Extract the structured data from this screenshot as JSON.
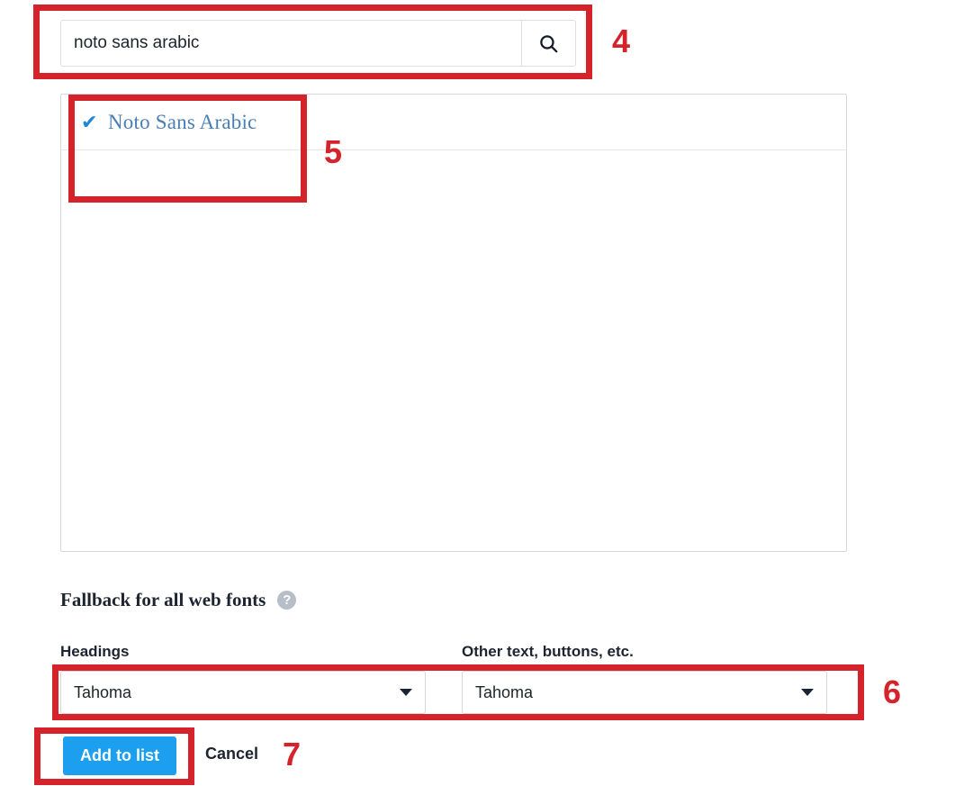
{
  "search": {
    "value": "noto sans arabic",
    "placeholder": "Search fonts",
    "button_icon": "search-icon"
  },
  "results": {
    "items": [
      {
        "name": "Noto Sans Arabic",
        "selected": true,
        "check_glyph": "✔"
      }
    ]
  },
  "fallback": {
    "title": "Fallback for all web fonts",
    "help_glyph": "?",
    "fields": [
      {
        "label": "Headings",
        "value": "Tahoma"
      },
      {
        "label": "Other text, buttons, etc.",
        "value": "Tahoma"
      }
    ],
    "caret_icon": "chevron-down-icon"
  },
  "actions": {
    "primary_label": "Add to list",
    "cancel_label": "Cancel"
  },
  "annotations": {
    "numbers": [
      "4",
      "5",
      "6",
      "7"
    ],
    "color": "#d4232b"
  },
  "colors": {
    "accent_blue": "#1d9ff0",
    "link_blue": "#4a7fb5",
    "check_blue": "#1d87d4",
    "annotation_red": "#d4232b",
    "border_grey": "#d4d8dd",
    "help_grey": "#b7bec8",
    "text_dark": "#1d2430"
  }
}
